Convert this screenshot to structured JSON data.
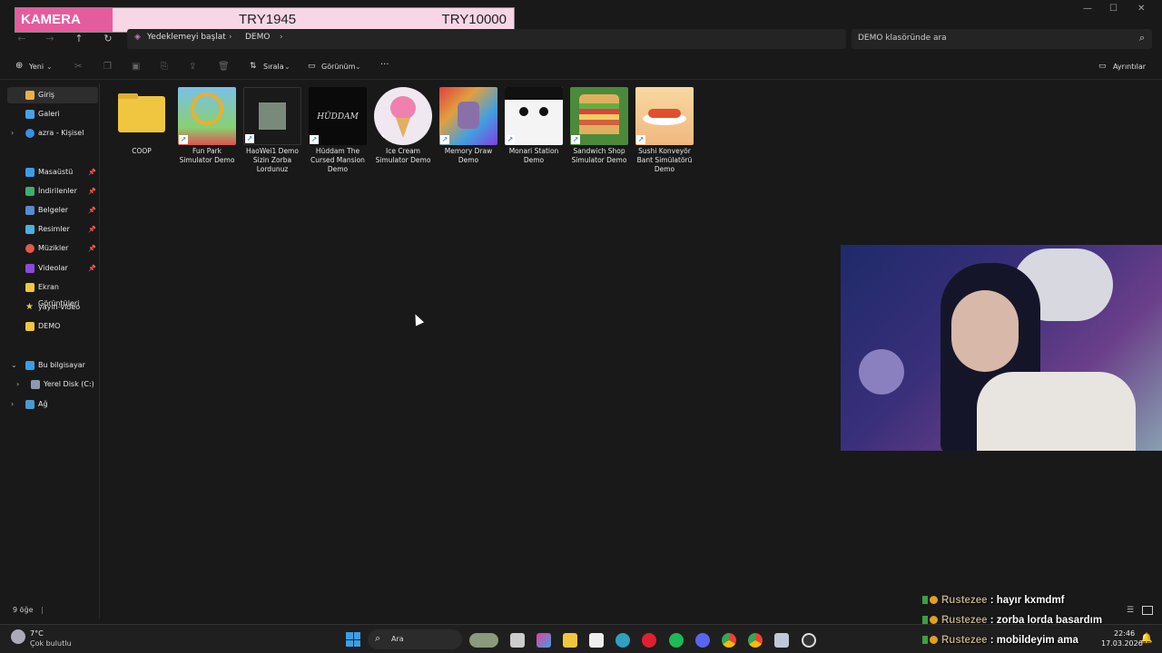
{
  "banner": {
    "left": "KAMERA",
    "middle": "TRY1945",
    "right": "TRY10000"
  },
  "address": {
    "backup": "Yedeklemeyi başlat",
    "folder": "DEMO"
  },
  "search": {
    "placeholder": "DEMO klasöründe ara"
  },
  "toolbar": {
    "new": "Yeni",
    "sort": "Sırala",
    "view": "Görünüm",
    "more": "···",
    "details": "Ayrıntılar"
  },
  "sidebar": {
    "items": [
      {
        "label": "Giriş"
      },
      {
        "label": "Galeri"
      },
      {
        "label": "azra - Kişisel"
      },
      {
        "label": "Masaüstü"
      },
      {
        "label": "İndirilenler"
      },
      {
        "label": "Belgeler"
      },
      {
        "label": "Resimler"
      },
      {
        "label": "Müzikler"
      },
      {
        "label": "Videolar"
      },
      {
        "label": "Ekran Görüntüleri"
      },
      {
        "label": "yayın-video"
      },
      {
        "label": "DEMO"
      },
      {
        "label": "Bu bilgisayar"
      },
      {
        "label": "Yerel Disk (C:)"
      },
      {
        "label": "Ağ"
      }
    ]
  },
  "files": [
    {
      "name": "COOP"
    },
    {
      "name": "Fun Park Simulator Demo"
    },
    {
      "name": "HaoWei1 Demo Sizin Zorba Lordunuz"
    },
    {
      "name": "Hüddam The Cursed Mansion Demo"
    },
    {
      "name": "Ice Cream Simulator Demo"
    },
    {
      "name": "Memory Draw Demo"
    },
    {
      "name": "Monari Station Demo"
    },
    {
      "name": "Sandwich Shop Simulator Demo"
    },
    {
      "name": "Sushi Konveyör Bant Simülatörü Demo"
    }
  ],
  "thumb_text": {
    "huddam": "HÜDDAM"
  },
  "status": {
    "count": "9 öğe"
  },
  "chat": [
    {
      "user": "Rustezee",
      "msg": "hayır kxmdmf"
    },
    {
      "user": "Rustezee",
      "msg": "zorba lorda basardım"
    },
    {
      "user": "Rustezee",
      "msg": "mobildeyim ama"
    }
  ],
  "taskbar": {
    "temp": "7°C",
    "weather": "Çok bulutlu",
    "search": "Ara",
    "time": "22:46",
    "date": "17.03.2026"
  },
  "colors": {
    "accent": "#e55c9e",
    "bg": "#191919",
    "folder": "#f0c640"
  }
}
